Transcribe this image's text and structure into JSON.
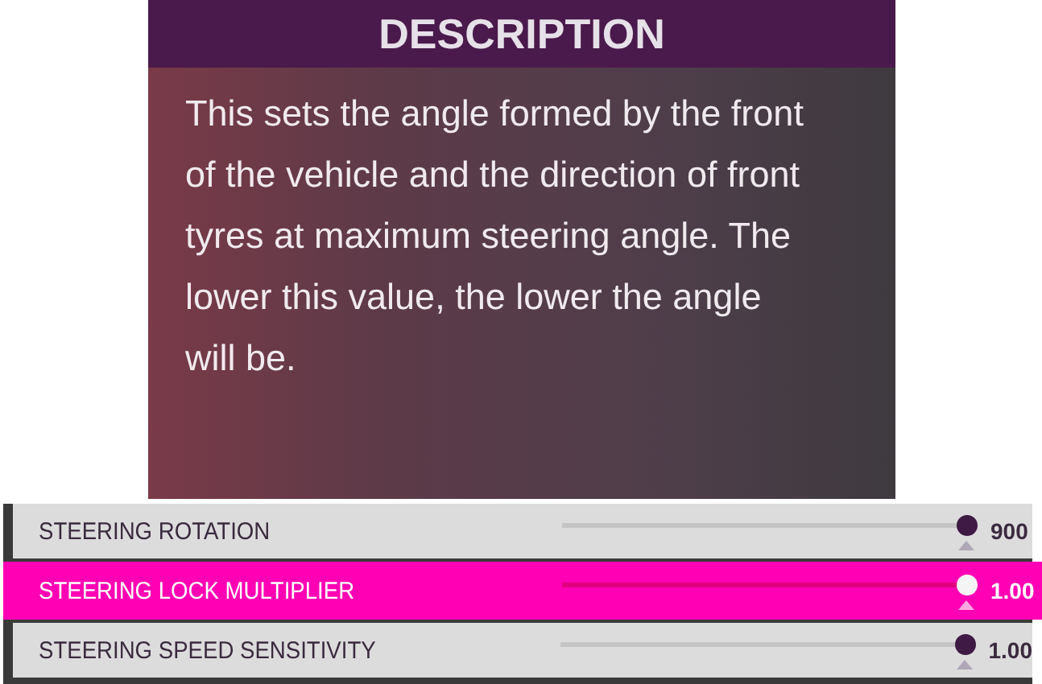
{
  "description": {
    "title": "DESCRIPTION",
    "text": "This sets the angle formed by the front of the vehicle and the direction of front tyres at maximum steering angle. The lower this value, the lower the angle will be."
  },
  "settings": [
    {
      "label": "STEERING ROTATION",
      "selected": false,
      "level": 1,
      "value": "900"
    },
    {
      "label": "STEERING LOCK MULTIPLIER",
      "selected": true,
      "level": 1,
      "value": "1.00"
    },
    {
      "label": "STEERING SPEED SENSITIVITY",
      "selected": false,
      "level": 1,
      "value": "1.00"
    }
  ]
}
